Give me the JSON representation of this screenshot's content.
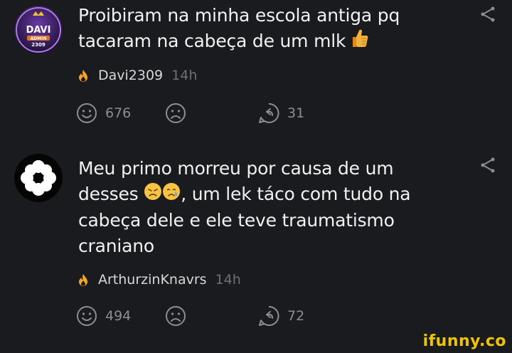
{
  "comments": [
    {
      "text": "Proibiram na minha escola antiga pq tacaram na cabeça de um mlk",
      "username": "Davi2309",
      "time": "14h",
      "smile_count": "676",
      "reply_count": "31",
      "avatar_text": [
        "DAVI",
        "ADMIN",
        "2309"
      ]
    },
    {
      "text_before_emoji": "Meu primo morreu por causa de um desses",
      "text_after_emoji": ", um lek táco com tudo na cabeça dele e ele teve traumatismo craniano",
      "username": "ArthurzinKnavrs",
      "time": "14h",
      "smile_count": "494",
      "reply_count": "72"
    }
  ],
  "watermark": "ifunny.co",
  "colors": {
    "background": "#1a1b1e",
    "text": "#f1f1f1",
    "muted": "#8d8d92",
    "flame": "#f5a623",
    "watermark": "#f0c400"
  }
}
